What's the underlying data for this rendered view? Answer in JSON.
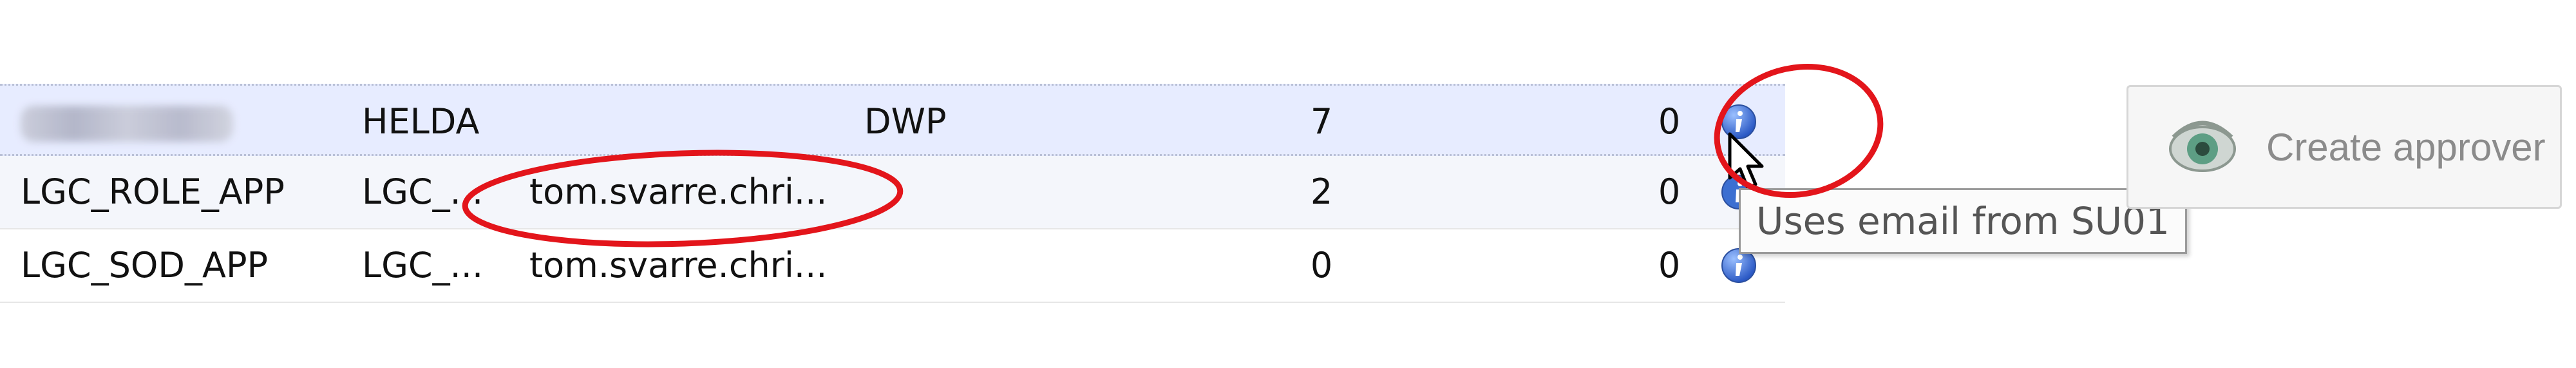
{
  "grid": {
    "rows": [
      {
        "name": "",
        "system": "HELDA",
        "email": "",
        "group": "DWP",
        "count1": "7",
        "count2": "0"
      },
      {
        "name": "LGC_ROLE_APP",
        "system": "LGC_...",
        "email": "tom.svarre.chri...",
        "group": "",
        "count1": "2",
        "count2": "0"
      },
      {
        "name": "LGC_SOD_APP",
        "system": "LGC_...",
        "email": "tom.svarre.chri...",
        "group": "",
        "count1": "0",
        "count2": "0"
      }
    ]
  },
  "tooltip": {
    "text": "Uses email from SU01"
  },
  "create_button": {
    "label": "Create approver"
  },
  "colors": {
    "selected_row": "#e7ecff",
    "annotation_red": "#e3151b",
    "info_icon": "#3c6fd1",
    "button_text": "#8b8b8b"
  },
  "icons": {
    "row_info": "info-icon",
    "cursor": "mouse-pointer-icon",
    "button": "eye-icon"
  }
}
